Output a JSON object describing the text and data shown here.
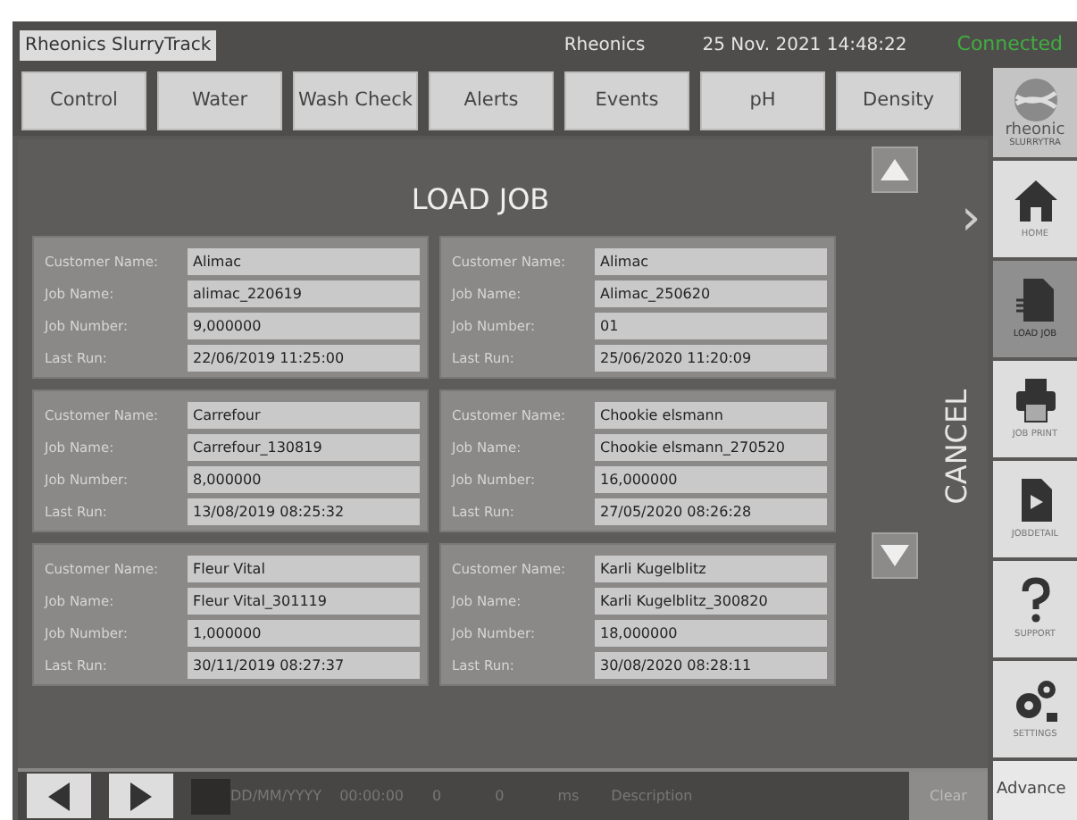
{
  "header": {
    "app_title": "Rheonics SlurryTrack",
    "company": "Rheonics",
    "datetime": "25 Nov. 2021 14:48:22",
    "connection": "Connected"
  },
  "tabs": [
    {
      "label": "Control",
      "selected": false
    },
    {
      "label": "Water",
      "selected": false
    },
    {
      "label": "Wash Check",
      "selected": false
    },
    {
      "label": "Alerts",
      "selected": false
    },
    {
      "label": "Events",
      "selected": false
    },
    {
      "label": "pH",
      "selected": false
    },
    {
      "label": "Density",
      "selected": false
    }
  ],
  "dialog": {
    "title": "LOAD JOB",
    "cancel": "CANCEL",
    "chevron": "›",
    "jobs": [
      {
        "fields": [
          {
            "label": "Customer Name:",
            "value": "Alimac"
          },
          {
            "label": "Job Name:",
            "value": "alimac_220619"
          },
          {
            "label": "Job Number:",
            "value": "9,000000"
          },
          {
            "label": "Last Run:",
            "value": "22/06/2019 11:25:00"
          }
        ]
      },
      {
        "fields": [
          {
            "label": "Customer Name:",
            "value": "Alimac"
          },
          {
            "label": "Job Name:",
            "value": "Alimac_250620"
          },
          {
            "label": "Job Number:",
            "value": "01"
          },
          {
            "label": "Last Run:",
            "value": "25/06/2020 11:20:09"
          }
        ]
      },
      {
        "fields": [
          {
            "label": "Customer Name:",
            "value": "Carrefour"
          },
          {
            "label": "Job Name:",
            "value": "Carrefour_130819"
          },
          {
            "label": "Job Number:",
            "value": "8,000000"
          },
          {
            "label": "Last Run:",
            "value": "13/08/2019 08:25:32"
          }
        ]
      },
      {
        "fields": [
          {
            "label": "Customer Name:",
            "value": "Chookie elsmann"
          },
          {
            "label": "Job Name:",
            "value": "Chookie elsmann_270520"
          },
          {
            "label": "Job Number:",
            "value": "16,000000"
          },
          {
            "label": "Last Run:",
            "value": "27/05/2020 08:26:28"
          }
        ]
      },
      {
        "fields": [
          {
            "label": "Customer Name:",
            "value": "Fleur Vital"
          },
          {
            "label": "Job Name:",
            "value": "Fleur Vital_301119"
          },
          {
            "label": "Job Number:",
            "value": "1,000000"
          },
          {
            "label": "Last Run:",
            "value": "30/11/2019 08:27:37"
          }
        ]
      },
      {
        "fields": [
          {
            "label": "Customer Name:",
            "value": "Karli Kugelblitz"
          },
          {
            "label": "Job Name:",
            "value": "Karli Kugelblitz_300820"
          },
          {
            "label": "Job Number:",
            "value": "18,000000"
          },
          {
            "label": "Last Run:",
            "value": "30/08/2020 08:28:11"
          }
        ]
      }
    ]
  },
  "sidebar": {
    "logo_text": "rheonic",
    "logo_sub": "SLURRYTRA",
    "items": [
      {
        "kind": "home",
        "label": "HOME",
        "selected": false
      },
      {
        "kind": "load",
        "label": "LOAD JOB",
        "selected": true
      },
      {
        "kind": "print",
        "label": "JOB PRINT",
        "selected": false
      },
      {
        "kind": "details",
        "label": "JOBDETAIL",
        "selected": false
      },
      {
        "kind": "support",
        "label": "SUPPORT",
        "selected": false
      },
      {
        "kind": "settings",
        "label": "SETTINGS",
        "selected": false
      }
    ],
    "advanced": "Advance"
  },
  "status_bar": {
    "date": "DD/MM/YYYY",
    "time": "00:00:00",
    "value_1": "0",
    "value_2": "0",
    "unit": "ms",
    "description": "Description",
    "clear": "Clear"
  }
}
